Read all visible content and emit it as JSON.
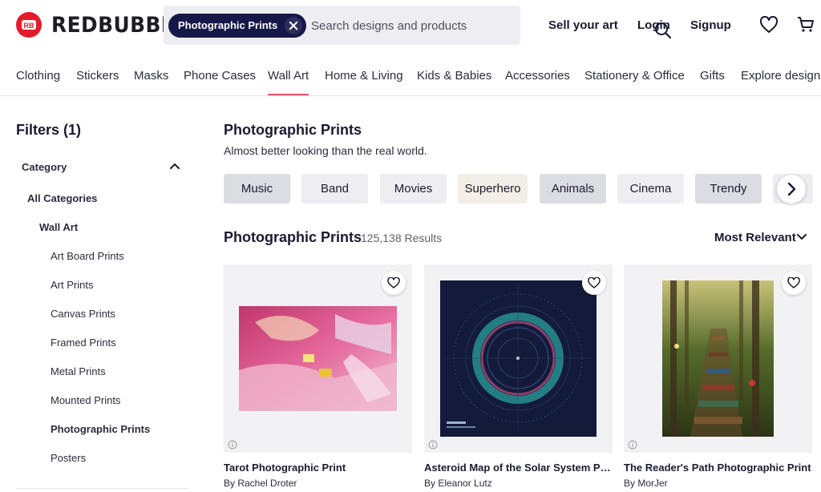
{
  "brand": {
    "name": "REDBUBBLE",
    "logo_letters": "RB",
    "color": "#e31c2b"
  },
  "search": {
    "chip_label": "Photographic Prints",
    "placeholder": "Search designs and products",
    "value": ""
  },
  "header_links": {
    "sell": "Sell your art",
    "login": "Login",
    "signup": "Signup"
  },
  "nav": [
    "Clothing",
    "Stickers",
    "Masks",
    "Phone Cases",
    "Wall Art",
    "Home & Living",
    "Kids & Babies",
    "Accessories",
    "Stationery & Office",
    "Gifts",
    "Explore designs"
  ],
  "nav_active": "Wall Art",
  "filters": {
    "title": "Filters (1)",
    "category_label": "Category",
    "all_categories": "All Categories",
    "parent": "Wall Art",
    "items": [
      "Art Board Prints",
      "Art Prints",
      "Canvas Prints",
      "Framed Prints",
      "Metal Prints",
      "Mounted Prints",
      "Photographic Prints",
      "Posters"
    ],
    "selected": "Photographic Prints"
  },
  "page": {
    "title": "Photographic Prints",
    "subtitle": "Almost better looking than the real world."
  },
  "tags": [
    "Music",
    "Band",
    "Movies",
    "Superhero",
    "Animals",
    "Cinema",
    "Trendy"
  ],
  "results": {
    "title": "Photographic Prints",
    "count": "125,138 Results",
    "sort": "Most Relevant"
  },
  "products": [
    {
      "title": "Tarot Photographic Print",
      "artist": "By Rachel Droter"
    },
    {
      "title": "Asteroid Map of the Solar System Photographic Print",
      "artist": "By Eleanor Lutz"
    },
    {
      "title": "The Reader's Path Photographic Print",
      "artist": "By MorJer"
    }
  ],
  "colors": {
    "accent": "#e5565f",
    "navy": "#17184a",
    "text": "#191b30"
  }
}
